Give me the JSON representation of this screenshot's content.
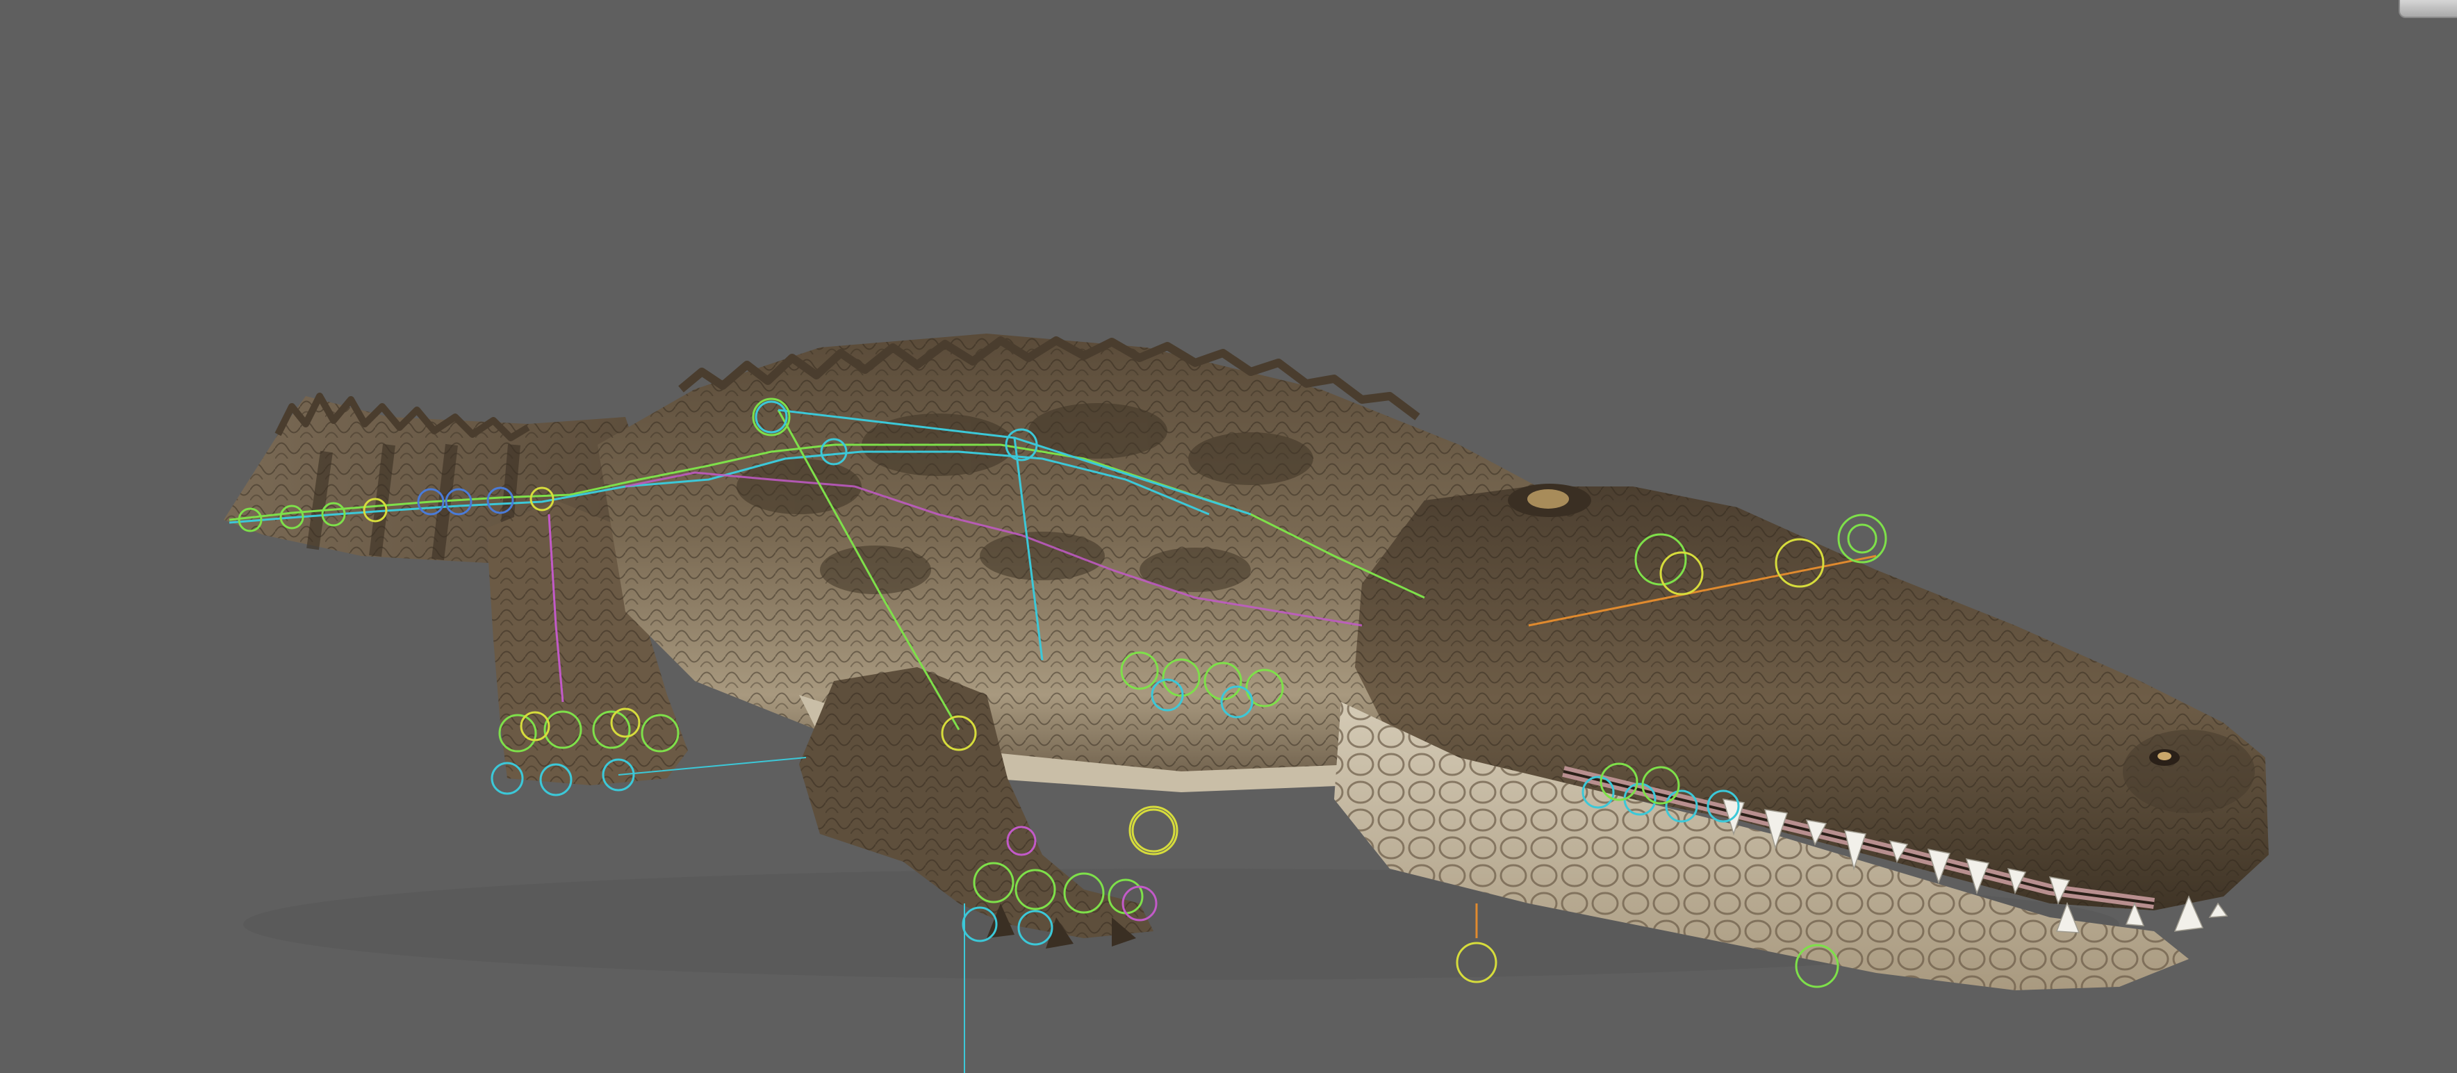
{
  "viewport": {
    "background_color": "#5f5f5f"
  },
  "scene": {
    "subject": "crocodile-rig",
    "rig_visible": true,
    "rig_colors": {
      "green": "#7ee04a",
      "yellow": "#d6dc3c",
      "cyan": "#3cc8d8",
      "blue": "#4a7bd8",
      "magenta": "#c25ac8",
      "orange": "#e08a2e"
    },
    "skin_colors": {
      "dark": "#3f3426",
      "mid": "#6e5d47",
      "light": "#b9ab92",
      "belly": "#d9d1bf",
      "teeth": "#f2f0ea",
      "gum": "#c9a0a0"
    }
  },
  "view_cube": {
    "icon": "view-cube-icon"
  }
}
